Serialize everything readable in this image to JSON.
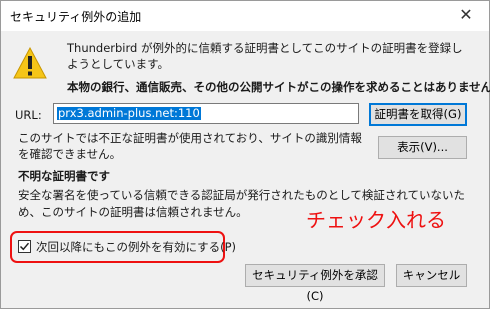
{
  "dialog": {
    "title": "セキュリティ例外の追加",
    "close_symbol": "✕"
  },
  "warning": {
    "message": "Thunderbird が例外的に信頼する証明書としてこのサイトの証明書を登録しようとしています。",
    "bold_message": "本物の銀行、通信販売、その他の公開サイトがこの操作を求めることはありません。"
  },
  "url": {
    "label": "URL:",
    "value": "prx3.admin-plus.net:110",
    "get_cert_button": "証明書を取得(G)"
  },
  "invalid_cert": {
    "text": "このサイトでは不正な証明書が使用されており、サイトの識別情報を確認できません。",
    "view_button": "表示(V)..."
  },
  "unknown_identity": {
    "heading": "不明な証明書です",
    "text": "安全な署名を使っている信頼できる認証局が発行されたものとして検証されていないため、このサイトの証明書は信頼されません。"
  },
  "annotation": {
    "text": "チェック入れる",
    "color": "#ee1111"
  },
  "permanent": {
    "label": "次回以降にもこの例外を有効にする(P)",
    "checked": true
  },
  "buttons": {
    "confirm": "セキュリティ例外を承認(C)",
    "cancel": "キャンセル"
  },
  "colors": {
    "selection": "#0078d7",
    "warning_yellow": "#f5c518"
  },
  "icons": {
    "warning": "warning-triangle-icon",
    "checkmark": "checkmark-icon",
    "close": "close-icon"
  }
}
